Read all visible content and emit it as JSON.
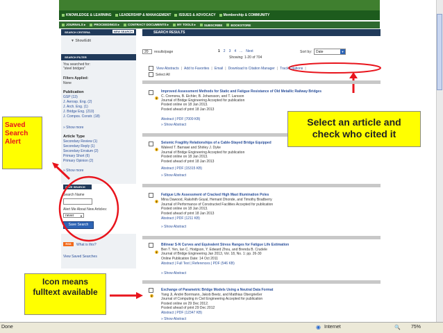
{
  "nav": {
    "items": [
      "KNOWLEDGE & LEARNING",
      "LEADERSHIP & MANAGEMENT",
      "ISSUES & ADVOCACY",
      "Membership & COMMUNITY"
    ],
    "sub_items": [
      "JOURNALS ▸",
      "PROCEEDINGS ▸",
      "CONTRACT DOCUMENTS ▸",
      "MY TOOLS ▸",
      "SUBSCRIBE",
      "BOOKSTORE"
    ]
  },
  "left": {
    "criteria_header": "SEARCH CRITERIA",
    "new_search": "NEW SEARCH",
    "show_edit": "Show/Edit",
    "filter_header": "SEARCH FILTER",
    "you_searched_label": "You searched for:",
    "you_searched_value": "\"steel bridges\"",
    "filters_applied_label": "Filters Applied:",
    "filters_applied_value": "None",
    "publication_label": "Publication",
    "publications": [
      "GSP (13)",
      "J. Aerosp. Eng. (2)",
      "J. Arch. Eng. (1)",
      "J. Bridge Eng. (210)",
      "J. Compos. Constr. (18)"
    ],
    "show_more_1": "» Show more",
    "article_type_label": "Article Type",
    "article_types": [
      "Secondary Review (1)",
      "Secondary Reply (1)",
      "Secondary Erratum (2)",
      "Primary Short (6)",
      "Primary Opinion (2)"
    ],
    "show_more_2": "» Show more",
    "save_search_header": "SAVE SEARCH",
    "search_name_label": "Search Name",
    "alert_label": "Alert Me About New Articles:",
    "alert_value": "never",
    "save_button": "Save Search",
    "rss_label": "RSS",
    "whats_this": "What is this?",
    "view_saved": "View Saved Searches"
  },
  "main": {
    "header": "SEARCH RESULTS",
    "per_page_value": "20",
    "per_page_label": "results/page",
    "pages": [
      "1",
      "2",
      "3",
      "4",
      "...",
      "Next"
    ],
    "showing": "Showing: 1-20 of 704",
    "sort_label": "Sort by:",
    "sort_value": "Date",
    "actions": [
      "View Abstracts",
      "Add to Favorites",
      "Email",
      "Download to Citation Manager",
      "Track Citations"
    ],
    "select_all": "Select All",
    "articles": [
      {
        "title": "Improved Assessment Methods for Static and Fatigue Resistance of Old Metallic Railway Bridges",
        "authors": "C. Cremona, B. Eichler, B. Johansson, and T. Larsson",
        "journal": "Journal of Bridge Engineering Accepted for publication",
        "online": "Posted online on 18 Jan 2013.",
        "ahead": "Posted ahead of print 18 Jan 2013",
        "links": "Abstract | PDF (7009 KB)",
        "show": "» Show Abstract"
      },
      {
        "title": "Seismic Fragility Relationships of a Cable-Stayed Bridge Equipped",
        "authors": "Waleed T. Barnawi and Shirley J. Dyke",
        "journal": "Journal of Bridge Engineering Accepted for publication",
        "online": "Posted online on 18 Jan 2013.",
        "ahead": "Posted ahead of print 18 Jan 2013",
        "links": "Abstract | PDF (15315 KB)",
        "show": "» Show Abstract"
      },
      {
        "title": "Fatigue Life Assessment of Cracked High Mast Illumination Poles",
        "authors": "Mina Dawood, Rakshith Goyal, Hemant Dhonde, and Timothy Bradberry",
        "journal": "Journal of Performance of Constructed Facilities Accepted for publication",
        "online": "Posted online on 18 Jan 2013.",
        "ahead": "Posted ahead of print 18 Jan 2013",
        "links": "Abstract | PDF (1211 KB)",
        "show": "» Show Abstract"
      },
      {
        "title": "Bilinear S-N Curves and Equivalent Stress Ranges for Fatigue Life Estimation",
        "authors": "Ben T. Yen, Ian C. Hodgson, Y. Edward Zhou, and Brenda B. Crudele",
        "journal": "Journal of Bridge Engineering Jan 2013, Vol. 18, No. 1: pp. 26-30",
        "online": "Online Publication Date: 14 Oct 2011",
        "ahead": "",
        "links": "Abstract | Full Text | References | PDF (546 KB)",
        "show": "» Show Abstract"
      },
      {
        "title": "Exchange of Parametric Bridge Models Using a Neutral Data Format",
        "authors": "Yang Ji, André Borrmann, Jakob Beetz, and Matthias Obergrießer",
        "journal": "Journal of Computing in Civil Engineering Accepted for publication",
        "online": "Posted online on 29 Dec 2012.",
        "ahead": "Posted ahead of print 29 Dec 2012",
        "links": "Abstract | PDF (12347 KB)",
        "show": "» Show Abstract"
      }
    ]
  },
  "callouts": {
    "saved": "Saved Search Alert",
    "select": "Select an article and check who cited it",
    "icon": "Icon means fulltext available"
  },
  "status": {
    "left": "Done",
    "zone": "Internet",
    "zoom": "75%"
  },
  "colors": {
    "accent_red": "#e8141c",
    "callout_yellow": "#ffff00",
    "nav_green": "#1d5b1d",
    "header_blue": "#203a5a"
  }
}
